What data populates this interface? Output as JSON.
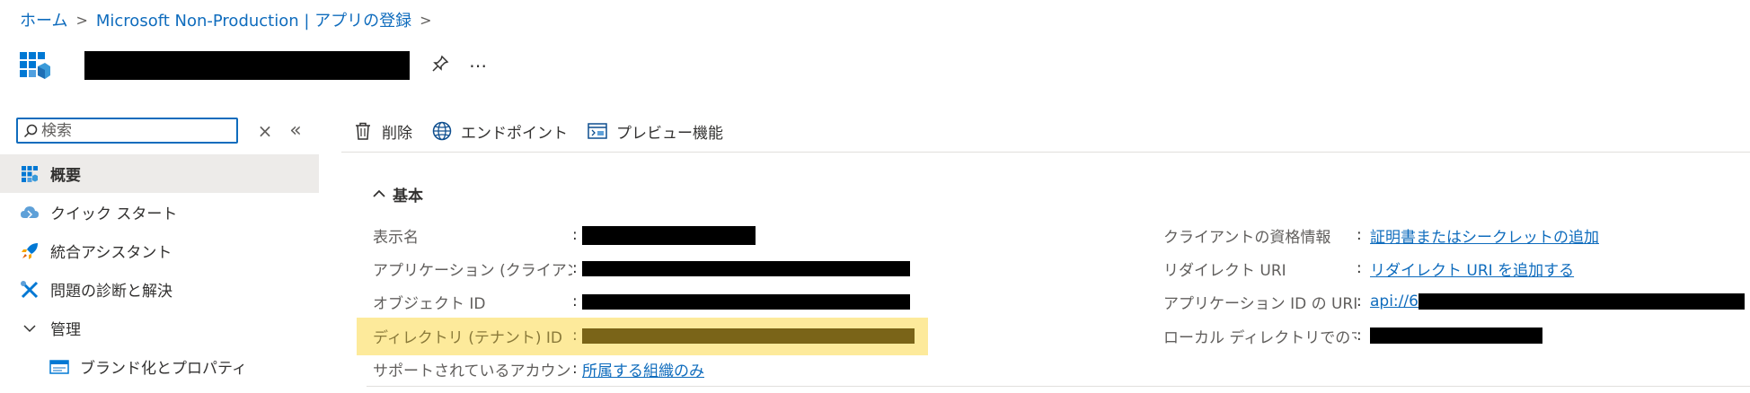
{
  "breadcrumb": {
    "home": "ホーム",
    "tenant": "Microsoft Non-Production | アプリの登録",
    "separator": ">"
  },
  "title": {
    "pin_label": "ピン留め",
    "more_label": "⋯"
  },
  "nav": {
    "search_placeholder": "検索",
    "clear_label": "×",
    "collapse_label": "«",
    "items": [
      {
        "label": "概要",
        "icon": "grid-icon"
      },
      {
        "label": "クイック スタート",
        "icon": "cloud-icon"
      },
      {
        "label": "統合アシスタント",
        "icon": "rocket-icon"
      },
      {
        "label": "問題の診断と解決",
        "icon": "tools-icon"
      },
      {
        "label": "管理",
        "icon": "chevron-down-icon"
      },
      {
        "label": "ブランド化とプロパティ",
        "icon": "branding-icon"
      }
    ]
  },
  "toolbar": {
    "delete": "削除",
    "endpoints": "エンドポイント",
    "preview": "プレビュー機能"
  },
  "essentials": {
    "header": "基本",
    "colon": ":",
    "left": [
      {
        "label": "表示名"
      },
      {
        "label": "アプリケーション (クライアント…"
      },
      {
        "label": "オブジェクト ID"
      },
      {
        "label": "ディレクトリ (テナント) ID"
      },
      {
        "label": "サポートされているアカウント…",
        "value": "所属する組織のみ"
      }
    ],
    "right": [
      {
        "label": "クライアントの資格情報",
        "value": "証明書またはシークレットの追加"
      },
      {
        "label": "リダイレクト URI",
        "value": "リダイレクト URI を追加する"
      },
      {
        "label": "アプリケーション ID の URI",
        "value": "api://6"
      },
      {
        "label": "ローカル ディレクトリでのマネ…"
      }
    ]
  },
  "colors": {
    "accent": "#0f6cbd",
    "highlight": "#fdea9b",
    "nav_active": "#edebe9"
  }
}
